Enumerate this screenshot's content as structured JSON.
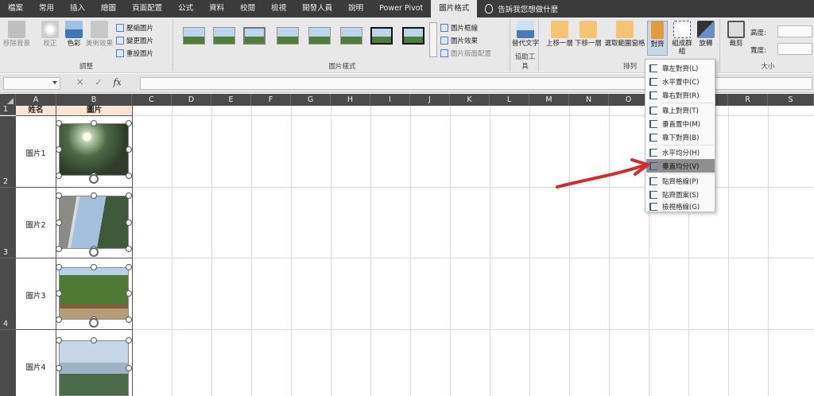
{
  "tabs": [
    "檔案",
    "常用",
    "插入",
    "繪圖",
    "頁面配置",
    "公式",
    "資料",
    "校閱",
    "檢視",
    "開發人員",
    "說明",
    "Power Pivot",
    "圖片格式"
  ],
  "tell_me": "告訴我您想做什麼",
  "ribbon": {
    "remove_bg": "移除背景",
    "correct": "校正",
    "color": "色彩",
    "artistic": "美術效果",
    "compress": "壓縮圖片",
    "change_pic": "變更圖片",
    "reset_pic": "重設圖片",
    "adjust_label": "調整",
    "border": "圖片框線",
    "effects": "圖片效果",
    "layout": "圖片版面配置",
    "styles_label": "圖片樣式",
    "alt_text": "替代文字",
    "accessibility_label": "協助工具",
    "bring_forward": "上移一層",
    "send_backward": "下移一層",
    "selection_pane": "選取範圍窗格",
    "align": "對齊",
    "group": "組成群組",
    "rotate": "旋轉",
    "arrange_label": "排列",
    "crop": "裁剪",
    "height": "高度:",
    "width": "寬度:",
    "size_label": "大小"
  },
  "formula_bar": {
    "cancel": "✕",
    "enter": "✓",
    "fx": "fx"
  },
  "columns": [
    "A",
    "B",
    "C",
    "D",
    "E",
    "F",
    "G",
    "H",
    "I",
    "J",
    "K",
    "L",
    "M",
    "N",
    "O",
    "P",
    "Q",
    "R",
    "S"
  ],
  "rows": [
    "1",
    "2",
    "3",
    "4"
  ],
  "header_cells": {
    "a1": "姓名",
    "b1": "圖片"
  },
  "names": [
    "圖片1",
    "圖片2",
    "圖片3",
    "圖片4"
  ],
  "align_menu": [
    "靠左對齊(L)",
    "水平置中(C)",
    "靠右對齊(R)",
    "靠上對齊(T)",
    "垂直置中(M)",
    "靠下對齊(B)",
    "水平均分(H)",
    "垂直均分(V)",
    "貼齊格線(P)",
    "貼齊圖案(S)",
    "檢視格線(G)"
  ],
  "highlighted_menu_item": "垂直均分(V)",
  "colors": {
    "tab_bar": "#3b3b3b",
    "ribbon": "#e8e8e8",
    "header_fill": "#fbe3d6",
    "arrow": "#d42a2a"
  }
}
